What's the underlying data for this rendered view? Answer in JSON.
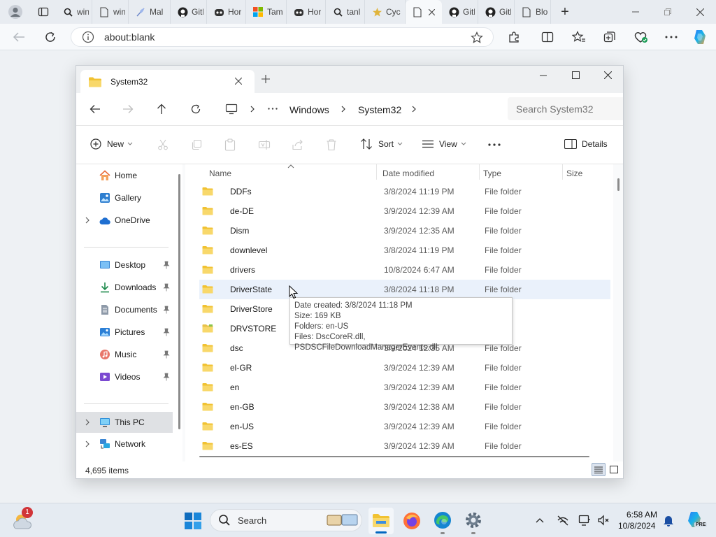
{
  "browser": {
    "tabs": [
      {
        "label": "win",
        "icon": "search-icon"
      },
      {
        "label": "win",
        "icon": "page-icon"
      },
      {
        "label": "Mal",
        "icon": "feather-icon"
      },
      {
        "label": "Gith",
        "icon": "github-icon"
      },
      {
        "label": "Hor",
        "icon": "copilot-icon"
      },
      {
        "label": "Tam",
        "icon": "windows-logo-icon"
      },
      {
        "label": "Hor",
        "icon": "copilot-icon"
      },
      {
        "label": "tanl",
        "icon": "search-icon"
      },
      {
        "label": "Cyc",
        "icon": "cyclist-icon"
      },
      {
        "label": "",
        "icon": "page-icon"
      },
      {
        "label": "Gith",
        "icon": "github-icon"
      },
      {
        "label": "Gith",
        "icon": "github-icon"
      },
      {
        "label": "Blo",
        "icon": "page-icon"
      }
    ],
    "address": "about:blank"
  },
  "explorer": {
    "tab_title": "System32",
    "breadcrumb": [
      "Windows",
      "System32"
    ],
    "search_placeholder": "Search System32",
    "commands": {
      "new": "New",
      "sort": "Sort",
      "view": "View",
      "details": "Details"
    },
    "sidebar": {
      "home": "Home",
      "gallery": "Gallery",
      "onedrive": "OneDrive",
      "desktop": "Desktop",
      "downloads": "Downloads",
      "documents": "Documents",
      "pictures": "Pictures",
      "music": "Music",
      "videos": "Videos",
      "thispc": "This PC",
      "network": "Network"
    },
    "columns": {
      "name": "Name",
      "date": "Date modified",
      "type": "Type",
      "size": "Size"
    },
    "rows": [
      {
        "name": "DDFs",
        "date": "3/8/2024 11:19 PM",
        "type": "File folder"
      },
      {
        "name": "de-DE",
        "date": "3/9/2024 12:39 AM",
        "type": "File folder"
      },
      {
        "name": "Dism",
        "date": "3/9/2024 12:35 AM",
        "type": "File folder"
      },
      {
        "name": "downlevel",
        "date": "3/8/2024 11:19 PM",
        "type": "File folder"
      },
      {
        "name": "drivers",
        "date": "10/8/2024 6:47 AM",
        "type": "File folder"
      },
      {
        "name": "DriverState",
        "date": "3/8/2024 11:18 PM",
        "type": "File folder"
      },
      {
        "name": "DriverStore",
        "date": "",
        "type": "lder"
      },
      {
        "name": "DRVSTORE",
        "date": "",
        "type": "lder"
      },
      {
        "name": "dsc",
        "date": "3/9/2024 12:35 AM",
        "type": "File folder"
      },
      {
        "name": "el-GR",
        "date": "3/9/2024 12:39 AM",
        "type": "File folder"
      },
      {
        "name": "en",
        "date": "3/9/2024 12:39 AM",
        "type": "File folder"
      },
      {
        "name": "en-GB",
        "date": "3/9/2024 12:38 AM",
        "type": "File folder"
      },
      {
        "name": "en-US",
        "date": "3/9/2024 12:39 AM",
        "type": "File folder"
      },
      {
        "name": "es-ES",
        "date": "3/9/2024 12:39 AM",
        "type": "File folder"
      }
    ],
    "tooltip": {
      "created": "Date created: 3/8/2024 11:18 PM",
      "size": "Size: 169 KB",
      "folders": "Folders: en-US",
      "files": "Files: DscCoreR.dll, PSDSCFileDownloadManagerEvents.dll"
    },
    "status": "4,695 items"
  },
  "taskbar": {
    "search_label": "Search",
    "time": "6:58 AM",
    "date": "10/8/2024",
    "weather_badge": "1",
    "copilot_badge": "PRE"
  }
}
